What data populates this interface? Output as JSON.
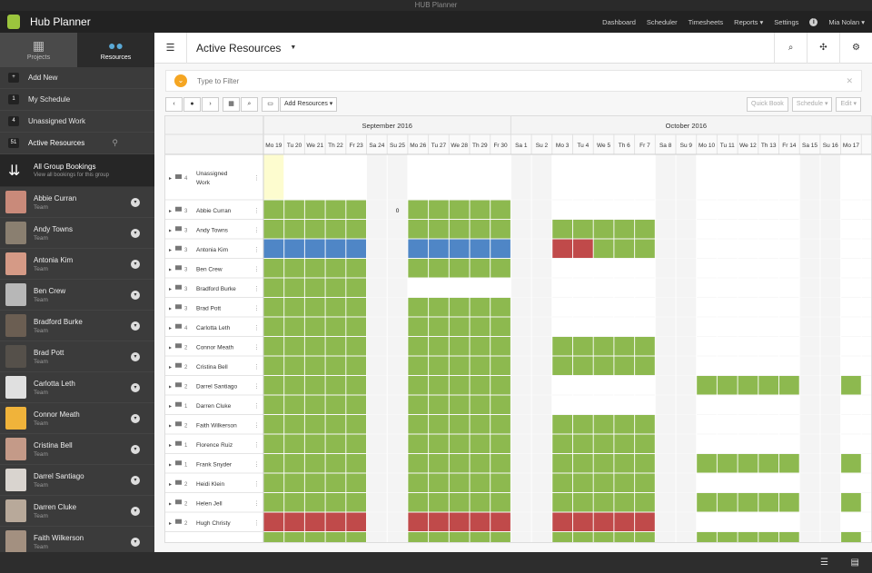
{
  "window": {
    "title": "HUB Planner"
  },
  "app": {
    "name": "Hub Planner"
  },
  "nav": {
    "items": [
      "Dashboard",
      "Scheduler",
      "Timesheets",
      "Reports ▾",
      "Settings"
    ],
    "user": "Mia Nolan ▾"
  },
  "sidebar": {
    "tabs": [
      {
        "label": "Projects",
        "icon": "▦"
      },
      {
        "label": "Resources",
        "icon": "●●"
      }
    ],
    "menu": [
      {
        "badge": "+",
        "label": "Add New"
      },
      {
        "badge": "1",
        "label": "My Schedule"
      },
      {
        "badge": "4",
        "label": "Unassigned Work"
      },
      {
        "badge": "51",
        "label": "Active Resources",
        "active": true
      }
    ],
    "group": {
      "title": "All Group Bookings",
      "subtitle": "View all bookings for this group"
    },
    "people": [
      {
        "name": "Abbie Curran",
        "role": "Team",
        "color": "#c98a7a"
      },
      {
        "name": "Andy Towns",
        "role": "Team",
        "color": "#8a7f70"
      },
      {
        "name": "Antonia Kim",
        "role": "Team",
        "color": "#d59a86"
      },
      {
        "name": "Ben Crew",
        "role": "Team",
        "color": "#b7b7b7"
      },
      {
        "name": "Bradford Burke",
        "role": "Team",
        "color": "#6b5e52"
      },
      {
        "name": "Brad Pott",
        "role": "Team",
        "color": "#55504a"
      },
      {
        "name": "Carlotta Leth",
        "role": "Team",
        "color": "#e0e0e0"
      },
      {
        "name": "Connor Meath",
        "role": "Team",
        "color": "#f0b33a"
      },
      {
        "name": "Cristina Bell",
        "role": "Team",
        "color": "#c49a88"
      },
      {
        "name": "Darrel Santiago",
        "role": "Team",
        "color": "#d9d4cf"
      },
      {
        "name": "Darren Cluke",
        "role": "Team",
        "color": "#b8a99a"
      },
      {
        "name": "Faith Wilkerson",
        "role": "Team",
        "color": "#a39080"
      }
    ]
  },
  "main": {
    "title": "Active Resources"
  },
  "filter": {
    "placeholder": "Type to Filter"
  },
  "toolbar": {
    "prev": "‹",
    "today": "●",
    "next": "›",
    "calendar": "▦",
    "zoom": "⌕",
    "screen": "▭",
    "add_resources": "Add Resources ▾",
    "quick_book": "Quick Book",
    "schedule": "Schedule ▾",
    "edit": "Edit ▾"
  },
  "months": [
    {
      "label": "September 2016",
      "start": 0,
      "count": 12
    },
    {
      "label": "October 2016",
      "start": 12,
      "count": 17
    }
  ],
  "days": [
    "Mo 19",
    "Tu 20",
    "We 21",
    "Th 22",
    "Fr 23",
    "Sa 24",
    "Su 25",
    "Mo 26",
    "Tu 27",
    "We 28",
    "Th 29",
    "Fr 30",
    "Sa 1",
    "Su 2",
    "Mo 3",
    "Tu 4",
    "We 5",
    "Th 6",
    "Fr 7",
    "Sa 8",
    "Su 9",
    "Mo 10",
    "Tu 11",
    "We 12",
    "Th 13",
    "Fr 14",
    "Sa 15",
    "Su 16",
    "Mo 17"
  ],
  "weekend_days": [
    5,
    6,
    12,
    13,
    19,
    20,
    26,
    27
  ],
  "today_index": 0,
  "rows": [
    {
      "name": "Unassigned Work",
      "count": "4",
      "tall": true,
      "bookings": []
    },
    {
      "name": "Abbie Curran",
      "count": "3",
      "count_cell": {
        "day": 6,
        "text": "0"
      },
      "bookings": [
        {
          "start": 0,
          "end": 4,
          "color": "green"
        },
        {
          "start": 7,
          "end": 11,
          "color": "green"
        }
      ]
    },
    {
      "name": "Andy Towns",
      "count": "3",
      "bookings": [
        {
          "start": 0,
          "end": 4,
          "color": "green"
        },
        {
          "start": 7,
          "end": 11,
          "color": "green"
        },
        {
          "start": 14,
          "end": 18,
          "color": "green"
        }
      ]
    },
    {
      "name": "Antonia Kim",
      "count": "3",
      "bookings": [
        {
          "start": 0,
          "end": 4,
          "color": "blue"
        },
        {
          "start": 7,
          "end": 11,
          "color": "blue"
        },
        {
          "start": 14,
          "end": 15,
          "color": "red"
        },
        {
          "start": 16,
          "end": 18,
          "color": "green"
        }
      ]
    },
    {
      "name": "Ben Crew",
      "count": "3",
      "bookings": [
        {
          "start": 0,
          "end": 4,
          "color": "green"
        },
        {
          "start": 7,
          "end": 11,
          "color": "green"
        }
      ]
    },
    {
      "name": "Bradford Burke",
      "count": "3",
      "bookings": [
        {
          "start": 0,
          "end": 4,
          "color": "green"
        }
      ]
    },
    {
      "name": "Brad Pott",
      "count": "3",
      "bookings": [
        {
          "start": 0,
          "end": 4,
          "color": "green"
        },
        {
          "start": 7,
          "end": 11,
          "color": "green"
        }
      ]
    },
    {
      "name": "Carlotta Leth",
      "count": "4",
      "bookings": [
        {
          "start": 0,
          "end": 4,
          "color": "green"
        },
        {
          "start": 7,
          "end": 11,
          "color": "green"
        }
      ]
    },
    {
      "name": "Connor Meath",
      "count": "2",
      "bookings": [
        {
          "start": 0,
          "end": 4,
          "color": "green"
        },
        {
          "start": 7,
          "end": 11,
          "color": "green"
        },
        {
          "start": 14,
          "end": 18,
          "color": "green"
        }
      ]
    },
    {
      "name": "Cristina Bell",
      "count": "2",
      "bookings": [
        {
          "start": 0,
          "end": 4,
          "color": "green"
        },
        {
          "start": 7,
          "end": 11,
          "color": "green"
        },
        {
          "start": 14,
          "end": 18,
          "color": "green"
        }
      ]
    },
    {
      "name": "Darrel Santiago",
      "count": "2",
      "bookings": [
        {
          "start": 0,
          "end": 4,
          "color": "green"
        },
        {
          "start": 7,
          "end": 11,
          "color": "green"
        },
        {
          "start": 21,
          "end": 25,
          "color": "green"
        },
        {
          "start": 28,
          "end": 28,
          "color": "green"
        }
      ]
    },
    {
      "name": "Darren Cluke",
      "count": "1",
      "bookings": [
        {
          "start": 0,
          "end": 4,
          "color": "green"
        },
        {
          "start": 7,
          "end": 11,
          "color": "green"
        }
      ]
    },
    {
      "name": "Faith Wilkerson",
      "count": "2",
      "bookings": [
        {
          "start": 0,
          "end": 4,
          "color": "green"
        },
        {
          "start": 7,
          "end": 11,
          "color": "green"
        },
        {
          "start": 14,
          "end": 18,
          "color": "green"
        }
      ]
    },
    {
      "name": "Florence Ruiz",
      "count": "1",
      "bookings": [
        {
          "start": 0,
          "end": 4,
          "color": "green"
        },
        {
          "start": 7,
          "end": 11,
          "color": "green"
        },
        {
          "start": 14,
          "end": 18,
          "color": "green"
        }
      ]
    },
    {
      "name": "Frank Snyder",
      "count": "1",
      "bookings": [
        {
          "start": 0,
          "end": 4,
          "color": "green"
        },
        {
          "start": 7,
          "end": 11,
          "color": "green"
        },
        {
          "start": 14,
          "end": 18,
          "color": "green"
        },
        {
          "start": 21,
          "end": 25,
          "color": "green"
        },
        {
          "start": 28,
          "end": 28,
          "color": "green"
        }
      ]
    },
    {
      "name": "Heidi Klein",
      "count": "2",
      "bookings": [
        {
          "start": 0,
          "end": 4,
          "color": "green"
        },
        {
          "start": 7,
          "end": 11,
          "color": "green"
        },
        {
          "start": 14,
          "end": 18,
          "color": "green"
        }
      ]
    },
    {
      "name": "Helen Jell",
      "count": "2",
      "bookings": [
        {
          "start": 0,
          "end": 4,
          "color": "green"
        },
        {
          "start": 7,
          "end": 11,
          "color": "green"
        },
        {
          "start": 14,
          "end": 18,
          "color": "green"
        },
        {
          "start": 21,
          "end": 25,
          "color": "green"
        },
        {
          "start": 28,
          "end": 28,
          "color": "green"
        }
      ]
    },
    {
      "name": "Hugh Christy",
      "count": "2",
      "bookings": [
        {
          "start": 0,
          "end": 4,
          "color": "red"
        },
        {
          "start": 7,
          "end": 11,
          "color": "red"
        },
        {
          "start": 14,
          "end": 18,
          "color": "red"
        }
      ]
    },
    {
      "name": "",
      "count": "",
      "bookings": [
        {
          "start": 0,
          "end": 4,
          "color": "green"
        },
        {
          "start": 7,
          "end": 11,
          "color": "green"
        },
        {
          "start": 14,
          "end": 18,
          "color": "green"
        },
        {
          "start": 21,
          "end": 25,
          "color": "green"
        },
        {
          "start": 28,
          "end": 28,
          "color": "green"
        }
      ]
    }
  ],
  "colors": {
    "green": "#8db94f",
    "blue": "#4f86c6",
    "red": "#c04a4a",
    "today": "#fdfccf",
    "weekend": "#f4f4f4",
    "accent": "#f5a623",
    "brand": "#9bc53d"
  }
}
